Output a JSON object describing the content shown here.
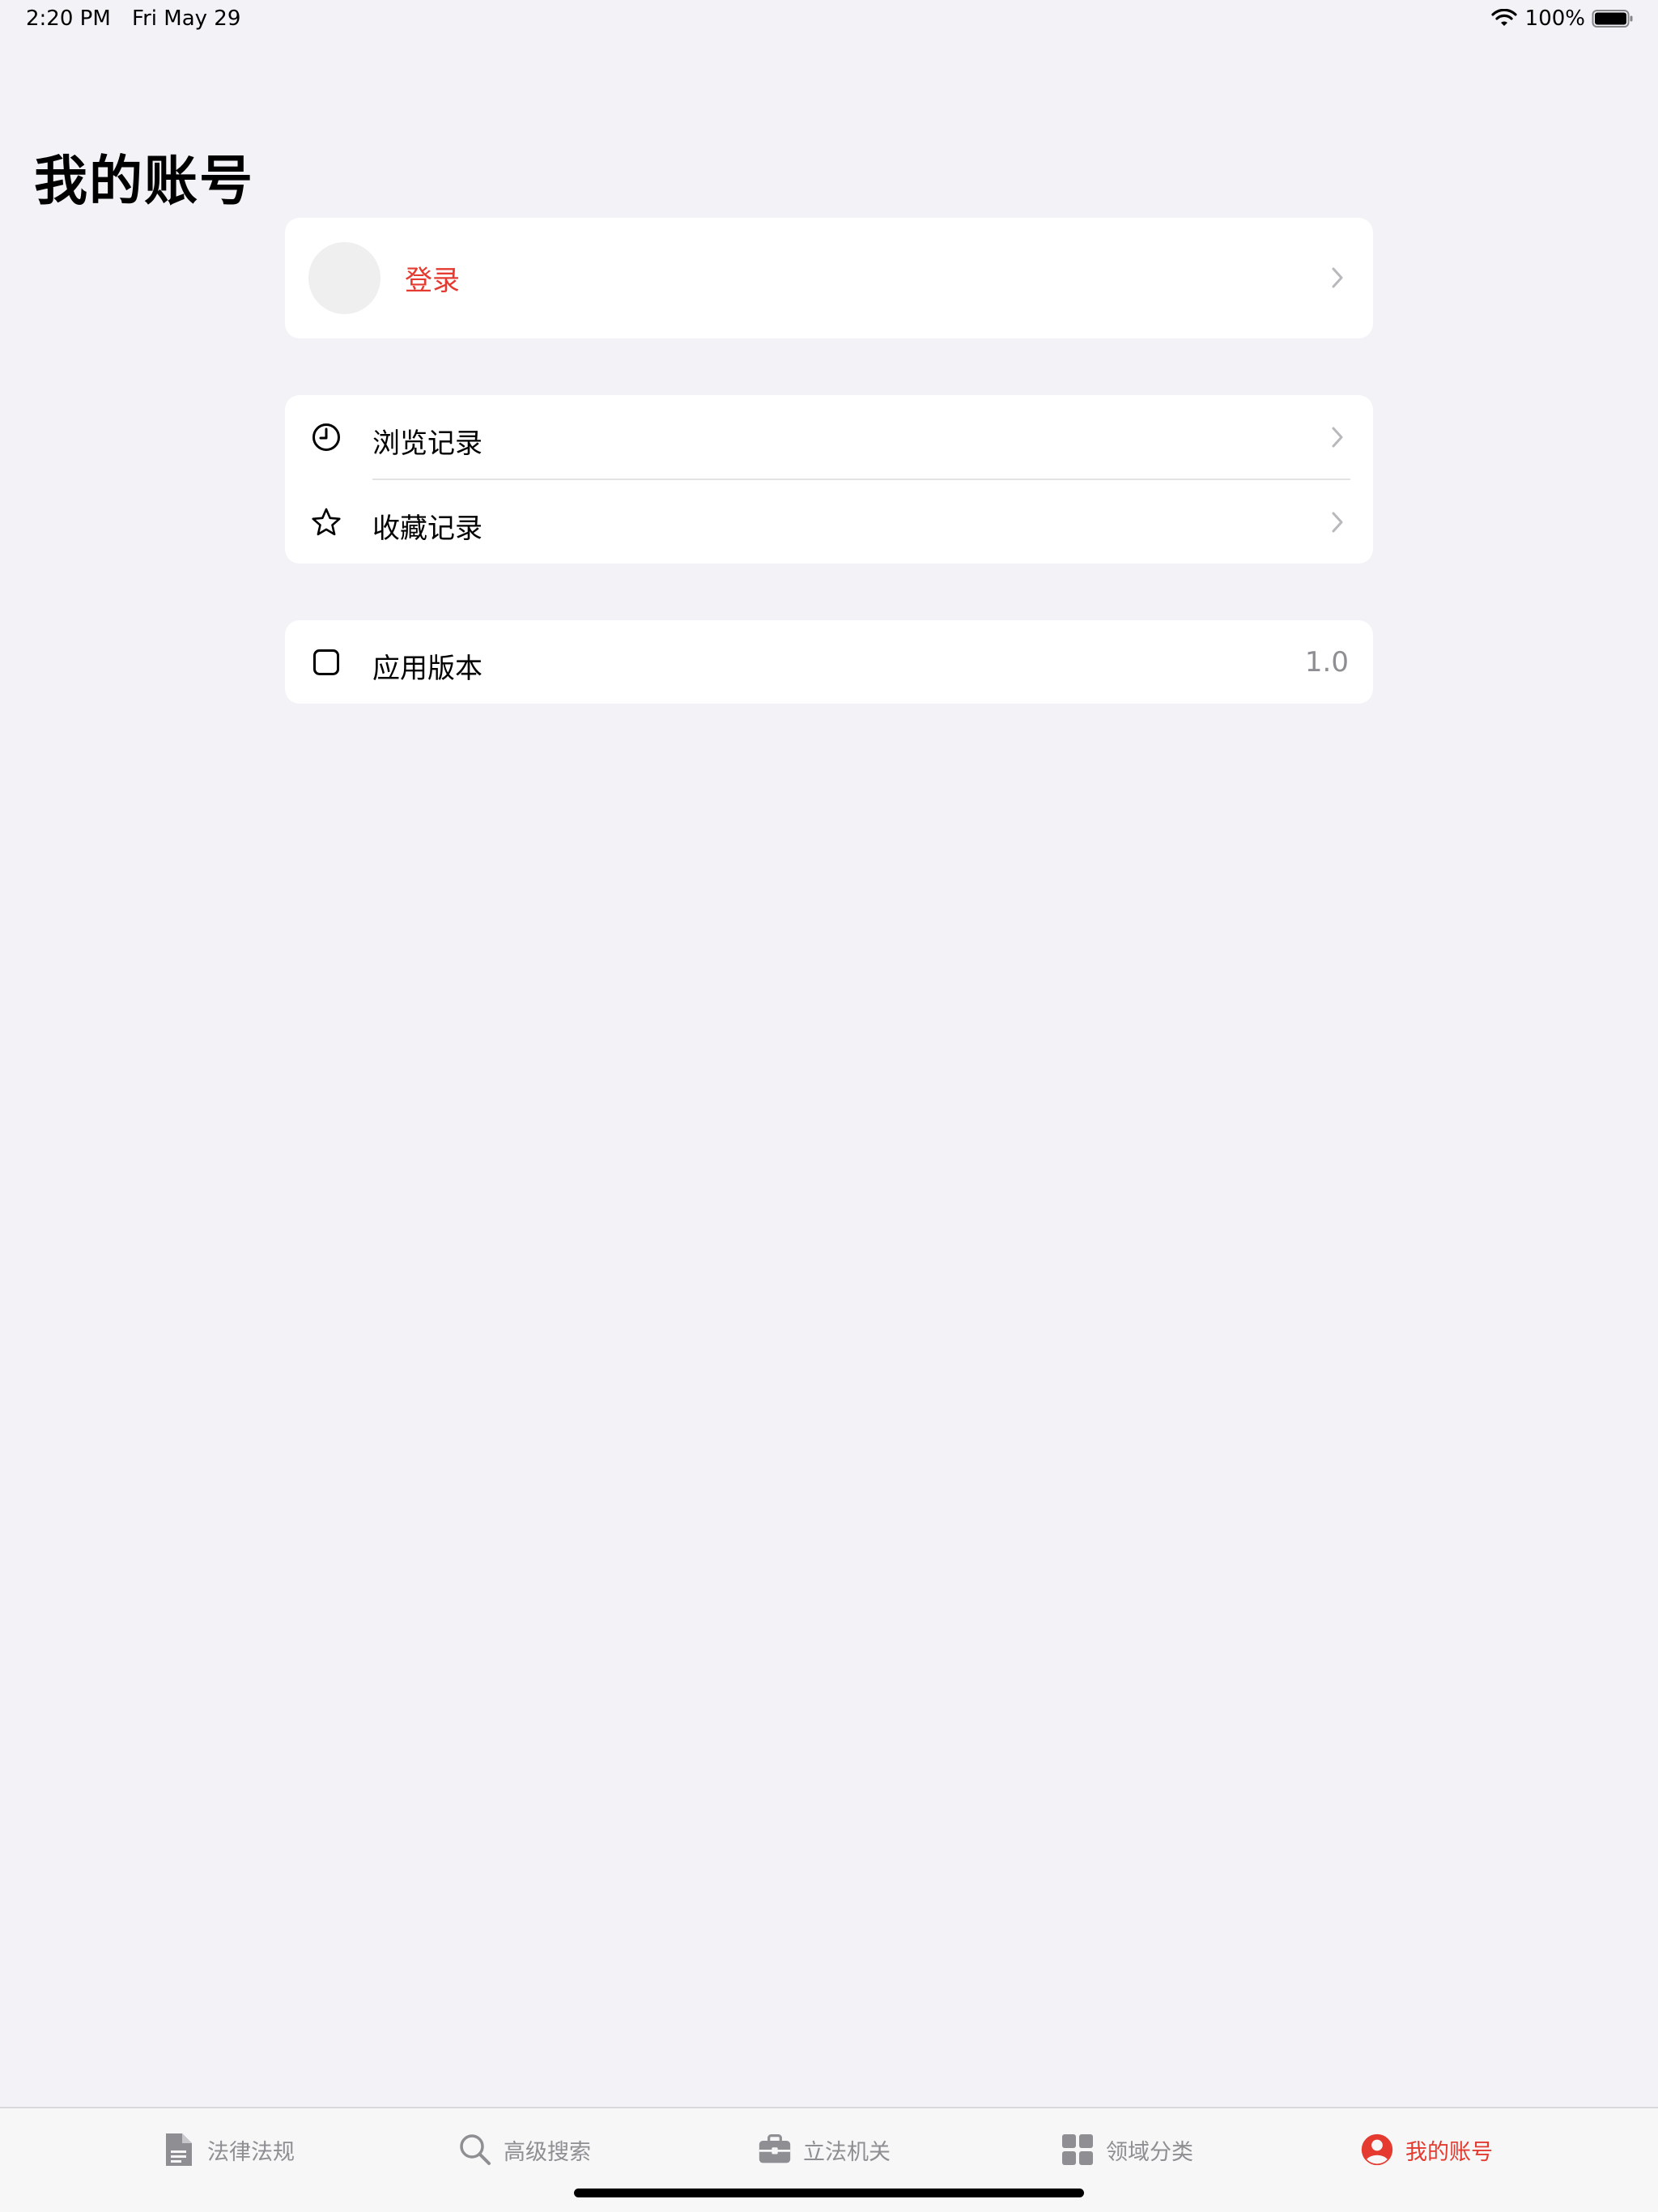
{
  "status_bar": {
    "time": "2:20 PM",
    "date": "Fri May 29",
    "battery_percent": "100%"
  },
  "page": {
    "title": "我的账号"
  },
  "login": {
    "label": "登录"
  },
  "records": {
    "history_label": "浏览记录",
    "favorites_label": "收藏记录"
  },
  "app_info": {
    "version_label": "应用版本",
    "version_value": "1.0"
  },
  "tabs": [
    {
      "label": "法律法规",
      "icon": "document-icon"
    },
    {
      "label": "高级搜索",
      "icon": "search-icon"
    },
    {
      "label": "立法机关",
      "icon": "briefcase-icon"
    },
    {
      "label": "领域分类",
      "icon": "grid-icon"
    },
    {
      "label": "我的账号",
      "icon": "person-circle-icon",
      "active": true
    }
  ],
  "colors": {
    "accent": "#e53a2f",
    "background": "#f2f2f7",
    "inactive_tab": "#8e8e93"
  }
}
